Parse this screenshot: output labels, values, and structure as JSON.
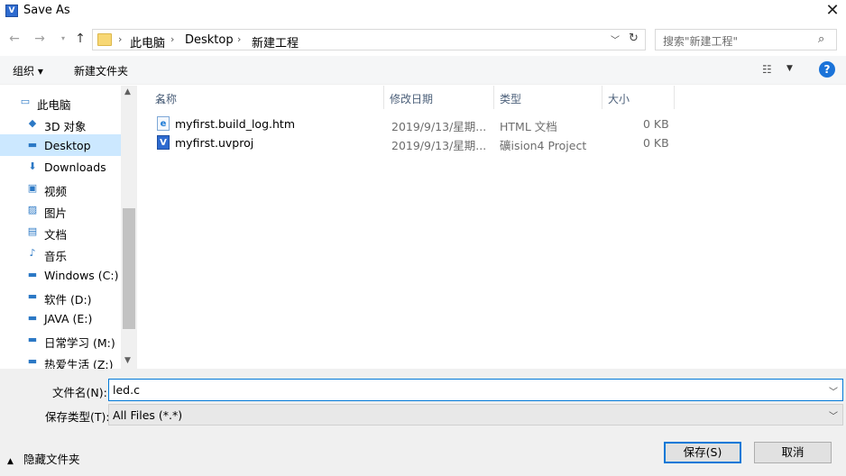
{
  "window": {
    "title": "Save As",
    "app_icon_letter": "V"
  },
  "nav": {
    "breadcrumbs": [
      "此电脑",
      "Desktop",
      "新建工程"
    ],
    "search_placeholder": "搜索\"新建工程\""
  },
  "toolbar": {
    "organize_label": "组织 ▾",
    "new_folder_label": "新建文件夹"
  },
  "sidebar": {
    "items": [
      {
        "label": "此电脑",
        "icon": "computer-icon",
        "glyph": "▭",
        "selected": false
      },
      {
        "label": "3D 对象",
        "icon": "3d-objects-icon",
        "glyph": "◆",
        "selected": false
      },
      {
        "label": "Desktop",
        "icon": "desktop-icon",
        "glyph": "▬",
        "selected": true
      },
      {
        "label": "Downloads",
        "icon": "downloads-icon",
        "glyph": "⬇",
        "selected": false
      },
      {
        "label": "视频",
        "icon": "videos-icon",
        "glyph": "▣",
        "selected": false
      },
      {
        "label": "图片",
        "icon": "pictures-icon",
        "glyph": "▨",
        "selected": false
      },
      {
        "label": "文档",
        "icon": "documents-icon",
        "glyph": "▤",
        "selected": false
      },
      {
        "label": "音乐",
        "icon": "music-icon",
        "glyph": "♪",
        "selected": false
      },
      {
        "label": "Windows (C:)",
        "icon": "drive-c-icon",
        "glyph": "▬",
        "selected": false
      },
      {
        "label": "软件 (D:)",
        "icon": "drive-icon",
        "glyph": "▬",
        "selected": false
      },
      {
        "label": "JAVA (E:)",
        "icon": "drive-icon",
        "glyph": "▬",
        "selected": false
      },
      {
        "label": "日常学习 (M:)",
        "icon": "drive-icon",
        "glyph": "▬",
        "selected": false
      },
      {
        "label": "热爱生活 (Z:)",
        "icon": "drive-icon",
        "glyph": "▬",
        "selected": false
      }
    ]
  },
  "columns": [
    "名称",
    "修改日期",
    "类型",
    "大小"
  ],
  "files": [
    {
      "name": "myfirst.build_log.htm",
      "date": "2019/9/13/星期...",
      "type": "HTML 文档",
      "size": "0 KB",
      "icon": "html-file-icon",
      "glyph": "e"
    },
    {
      "name": "myfirst.uvproj",
      "date": "2019/9/13/星期...",
      "type": "礦ision4 Project",
      "size": "0 KB",
      "icon": "uvision-project-icon",
      "glyph": "V"
    }
  ],
  "form": {
    "filename_label": "文件名(N):",
    "filename_value": "led.c",
    "filetype_label": "保存类型(T):",
    "filetype_value": "All Files (*.*)"
  },
  "footer": {
    "hide_folders_label": "隐藏文件夹",
    "save_label": "保存(S)",
    "cancel_label": "取消"
  },
  "colors": {
    "accent": "#0078d7",
    "selected_bg": "#cce8ff"
  }
}
